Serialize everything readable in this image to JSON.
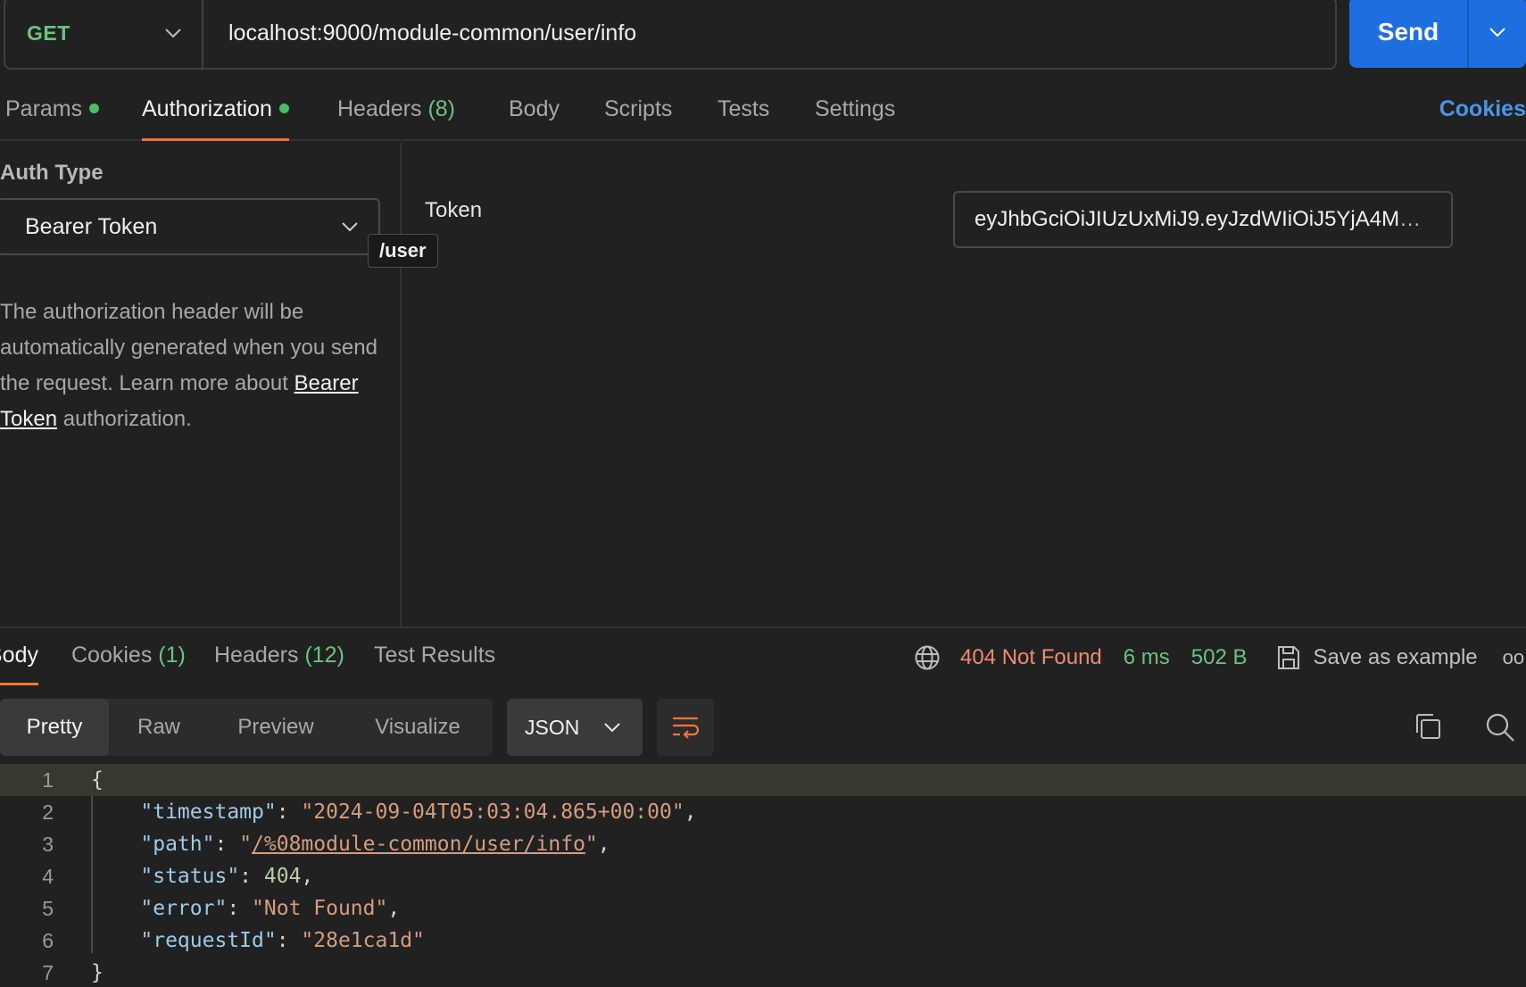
{
  "request": {
    "method": "GET",
    "url": "localhost:9000/module-common/user/info",
    "send_label": "Send"
  },
  "req_tabs": {
    "params": "Params",
    "authorization": "Authorization",
    "headers": "Headers",
    "headers_count": "(8)",
    "body": "Body",
    "scripts": "Scripts",
    "tests": "Tests",
    "settings": "Settings",
    "cookies": "Cookies"
  },
  "auth": {
    "type_label": "Auth Type",
    "type_value": "Bearer Token",
    "tooltip": "/user",
    "desc_1": "The authorization header will be automatically generated when you send the request. Learn more about ",
    "desc_link": "Bearer Token",
    "desc_2": " authorization.",
    "token_label": "Token",
    "token_value": "eyJhbGciOiJIUzUxMiJ9.eyJzdWIiOiJ5YjA4M"
  },
  "response": {
    "tabs": {
      "body": "Body",
      "cookies": "Cookies",
      "cookies_count": "(1)",
      "headers": "Headers",
      "headers_count": "(12)",
      "test_results": "Test Results"
    },
    "status": "404 Not Found",
    "time": "6 ms",
    "size": "502 B",
    "save_example": "Save as example",
    "more": "oo",
    "views": [
      "Pretty",
      "Raw",
      "Preview",
      "Visualize"
    ],
    "format": "JSON"
  },
  "code": {
    "line_numbers": [
      "1",
      "2",
      "3",
      "4",
      "5",
      "6",
      "7"
    ],
    "open": "{",
    "close": "}",
    "timestamp_key": "\"timestamp\"",
    "timestamp_val": "\"2024-09-04T05:03:04.865+00:00\"",
    "path_key": "\"path\"",
    "path_val": "/%08module-common/user/info",
    "status_key": "\"status\"",
    "status_val": "404",
    "error_key": "\"error\"",
    "error_val": "\"Not Found\"",
    "requestId_key": "\"requestId\"",
    "requestId_val": "\"28e1ca1d\""
  }
}
